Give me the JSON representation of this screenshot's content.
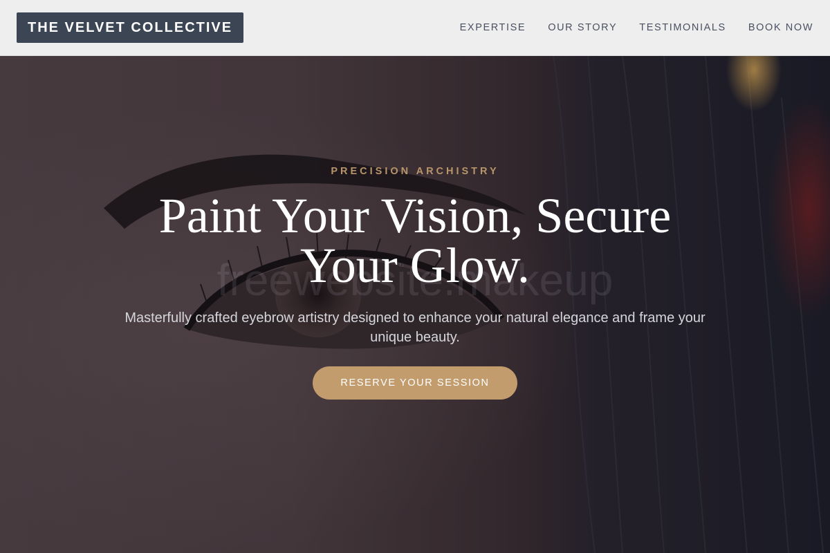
{
  "header": {
    "logo": "THE VELVET COLLECTIVE",
    "nav": [
      {
        "label": "EXPERTISE"
      },
      {
        "label": "OUR STORY"
      },
      {
        "label": "TESTIMONIALS"
      },
      {
        "label": "BOOK NOW"
      }
    ]
  },
  "hero": {
    "eyebrow": "PRECISION ARCHISTRY",
    "headline": "Paint Your Vision, Secure Your Glow.",
    "subhead": "Masterfully crafted eyebrow artistry designed to enhance your natural elegance and frame your unique beauty.",
    "cta_label": "RESERVE YOUR SESSION",
    "watermark": "freewebsite.makeup"
  },
  "colors": {
    "accent": "#c29c6d",
    "logo_bg": "#3c4554",
    "header_bg": "#eeeeef"
  }
}
